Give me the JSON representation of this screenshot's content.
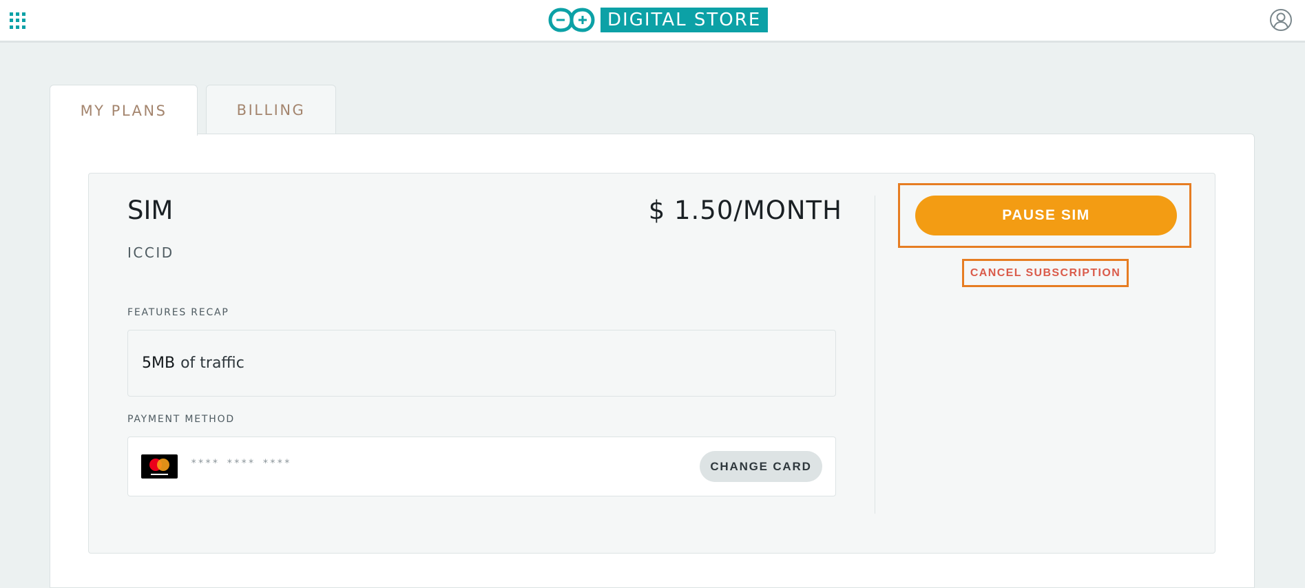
{
  "header": {
    "brand_text": "DIGITAL STORE",
    "apps_icon": "grid-apps-icon",
    "logo_icon": "infinity-logo-icon",
    "user_icon": "user-circle-icon",
    "accent_color": "#0ca1a6"
  },
  "tabs": [
    {
      "label": "MY PLANS",
      "active": true
    },
    {
      "label": "BILLING",
      "active": false
    }
  ],
  "plan": {
    "name": "SIM",
    "price": "$ 1.50/MONTH",
    "iccid_label": "ICCID",
    "features_label": "FEATURES RECAP",
    "features": {
      "amount": "5MB",
      "rest": "of traffic"
    },
    "payment_label": "PAYMENT METHOD",
    "card_brand": "mastercard",
    "card_mask": "**** **** ****",
    "change_card_label": "CHANGE CARD"
  },
  "actions": {
    "pause_label": "PAUSE SIM",
    "pause_color": "#f39c13",
    "cancel_label": "CANCEL SUBSCRIPTION",
    "cancel_color": "#da5b4a",
    "highlight_color": "#e67d22"
  }
}
